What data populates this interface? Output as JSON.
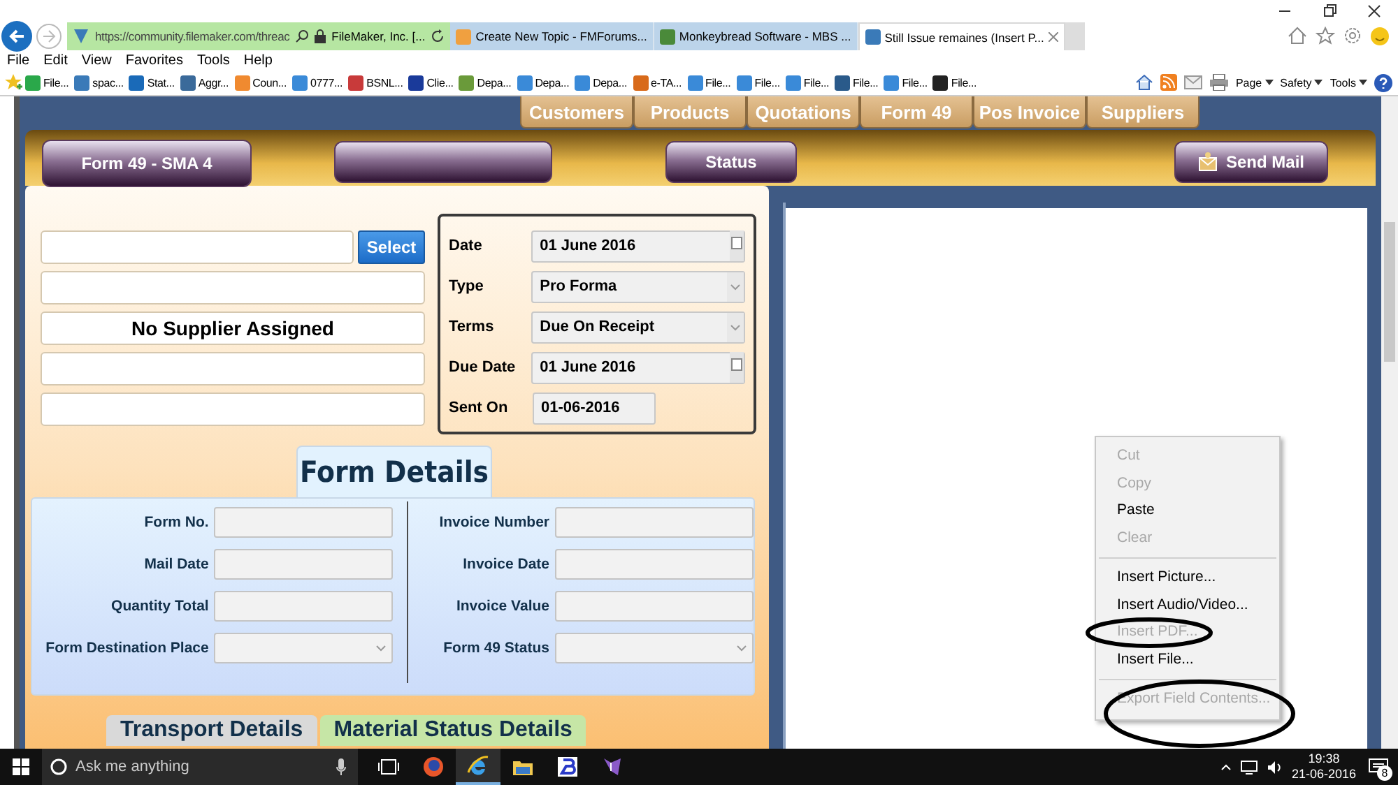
{
  "browser": {
    "address": "https://community.filemaker.com/threac",
    "site_identity": "FileMaker, Inc. [...",
    "tabs": [
      {
        "title": "Create New Topic - FMForums...",
        "selected": false
      },
      {
        "title": "Monkeybread Software - MBS ...",
        "selected": false
      },
      {
        "title": "Still Issue remaines (Insert P...",
        "selected": true
      }
    ],
    "menu": [
      "File",
      "Edit",
      "View",
      "Favorites",
      "Tools",
      "Help"
    ],
    "favorites": [
      "File...",
      "spac...",
      "Stat...",
      "Aggr...",
      "Coun...",
      "0777...",
      "BSNL...",
      "Clie...",
      "Depa...",
      "Depa...",
      "Depa...",
      "e-TA...",
      "File...",
      "File...",
      "File...",
      "File...",
      "File...",
      "File..."
    ],
    "commands": [
      "Page",
      "Safety",
      "Tools"
    ]
  },
  "nav_tabs": [
    "Customers",
    "Products",
    "Quotations",
    "Form 49",
    "Pos Invoice",
    "Suppliers"
  ],
  "toolbar_buttons": [
    {
      "kind": "tab",
      "label": "Form 49 - SMA 4"
    },
    {
      "kind": "blank"
    },
    {
      "kind": "button",
      "label": "Status"
    },
    {
      "kind": "mail",
      "label": "Send Mail"
    }
  ],
  "supplier": {
    "button": "Select",
    "lines": [
      {
        "kind": "field"
      },
      {
        "kind": "field"
      },
      {
        "kind": "name",
        "value": "No Supplier Assigned"
      },
      {
        "kind": "field"
      },
      {
        "kind": "field"
      }
    ]
  },
  "dates": [
    {
      "label": "Date",
      "value": "01 June 2016",
      "kind": "date"
    },
    {
      "label": "Type",
      "value": "Pro Forma",
      "kind": "popup"
    },
    {
      "label": "Terms",
      "value": "Due On Receipt",
      "kind": "popup"
    },
    {
      "label": "Due Date",
      "value": "01 June 2016",
      "kind": "date"
    },
    {
      "label": "Sent On",
      "value": "01-06-2016",
      "kind": "text"
    }
  ],
  "form_details": {
    "title": "Form Details",
    "left": [
      {
        "label": "Form No.",
        "kind": "text"
      },
      {
        "label": "Mail Date",
        "kind": "text"
      },
      {
        "label": "Quantity Total",
        "kind": "text"
      },
      {
        "label": "Form Destination Place",
        "kind": "popup"
      }
    ],
    "right": [
      {
        "label": "Invoice Number",
        "kind": "text"
      },
      {
        "label": "Invoice Date",
        "kind": "text"
      },
      {
        "label": "Invoice Value",
        "kind": "text"
      },
      {
        "label": "Form 49 Status",
        "kind": "popup"
      }
    ]
  },
  "bottom_tabs": [
    {
      "label": "Transport Details",
      "color": "#d9d9d9"
    },
    {
      "label": "Material Status Details",
      "color": "#c6e6a6"
    }
  ],
  "context_menu": [
    {
      "kind": "item",
      "label": "Cut",
      "disabled": true
    },
    {
      "kind": "item",
      "label": "Copy",
      "disabled": true
    },
    {
      "kind": "item",
      "label": "Paste",
      "disabled": false
    },
    {
      "kind": "item",
      "label": "Clear",
      "disabled": true
    },
    {
      "kind": "separator"
    },
    {
      "kind": "item",
      "label": "Insert Picture...",
      "disabled": false
    },
    {
      "kind": "item",
      "label": "Insert Audio/Video...",
      "disabled": false
    },
    {
      "kind": "item",
      "label": "Insert PDF...",
      "disabled": true
    },
    {
      "kind": "item",
      "label": "Insert File...",
      "disabled": false
    },
    {
      "kind": "separator"
    },
    {
      "kind": "item",
      "label": "Export Field Contents...",
      "disabled": true
    }
  ],
  "taskbar": {
    "search_placeholder": "Ask me anything",
    "time": "19:38",
    "date": "21-06-2016",
    "notifications": "8"
  }
}
